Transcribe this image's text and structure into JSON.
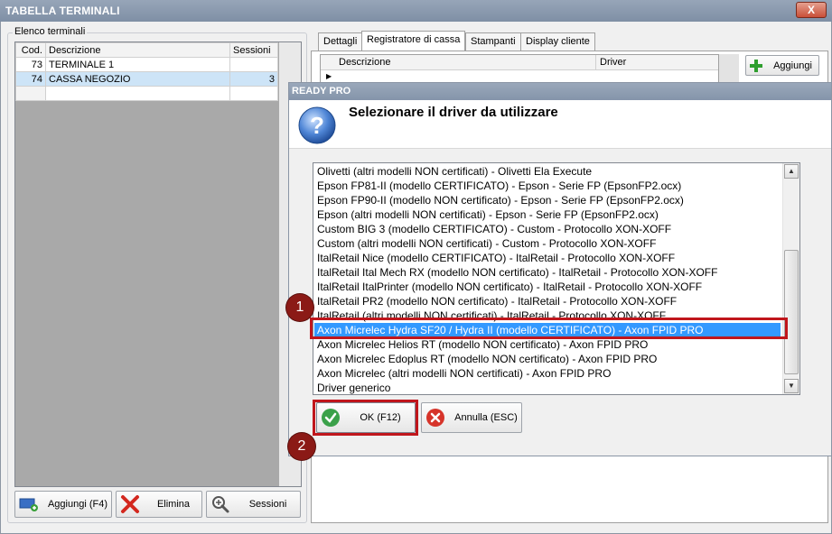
{
  "window": {
    "title": "TABELLA TERMINALI",
    "close_glyph": "X"
  },
  "left": {
    "group_label": "Elenco terminali",
    "columns": [
      "Cod.",
      "Descrizione",
      "Sessioni"
    ],
    "rows": [
      {
        "cod": "73",
        "descrizione": "TERMINALE 1",
        "sessioni": ""
      },
      {
        "cod": "74",
        "descrizione": "CASSA NEGOZIO",
        "sessioni": "3"
      }
    ],
    "buttons": {
      "add": "Aggiungi (F4)",
      "delete": "Elimina",
      "sessions": "Sessioni"
    }
  },
  "tabs": [
    "Dettagli",
    "Registratore di cassa",
    "Stampanti",
    "Display cliente"
  ],
  "active_tab": "Registratore di cassa",
  "cash_register": {
    "columns": [
      "Descrizione",
      "Driver"
    ],
    "add_button": "Aggiungi"
  },
  "dialog": {
    "title": "READY PRO",
    "question": "Selezionare il driver da utilizzare",
    "options": [
      "Olivetti (altri modelli NON certificati) - Olivetti Ela Execute",
      "Epson FP81-II (modello CERTIFICATO) - Epson - Serie FP (EpsonFP2.ocx)",
      "Epson FP90-II (modello NON certificato) - Epson - Serie FP (EpsonFP2.ocx)",
      "Epson (altri modelli NON certificati) - Epson - Serie FP (EpsonFP2.ocx)",
      "Custom BIG 3 (modello CERTIFICATO) - Custom - Protocollo XON-XOFF",
      "Custom (altri modelli NON certificati) - Custom - Protocollo XON-XOFF",
      "ItalRetail Nice (modello CERTIFICATO) - ItalRetail - Protocollo XON-XOFF",
      "ItalRetail Ital Mech RX (modello NON certificato) - ItalRetail - Protocollo XON-XOFF",
      "ItalRetail ItalPrinter (modello NON certificato) - ItalRetail - Protocollo XON-XOFF",
      "ItalRetail PR2 (modello NON certificato) - ItalRetail - Protocollo XON-XOFF",
      "ItalRetail (altri modelli NON certificati) - ItalRetail - Protocollo XON-XOFF",
      "Axon Micrelec Hydra SF20 / Hydra II (modello CERTIFICATO) - Axon FPID PRO",
      "Axon Micrelec Helios RT (modello NON certificato) - Axon FPID PRO",
      "Axon Micrelec Edoplus RT (modello NON certificato) - Axon FPID PRO",
      "Axon Micrelec (altri modelli NON certificati) - Axon FPID PRO",
      "Driver generico"
    ],
    "selected_index": 11,
    "ok_label": "OK (F12)",
    "cancel_label": "Annulla (ESC)"
  },
  "annotations": {
    "marker_1": "1",
    "marker_2": "2"
  },
  "colors": {
    "selection": "#3399ff",
    "highlight": "#c0161c",
    "marker": "#8b1a16",
    "title_bar": "#8494aa"
  },
  "icons": {
    "question": "question-icon",
    "ok": "checkmark-icon",
    "cancel": "cancel-x-icon",
    "add": "plus-icon",
    "delete": "delete-x-icon",
    "sessions": "magnifier-icon"
  }
}
